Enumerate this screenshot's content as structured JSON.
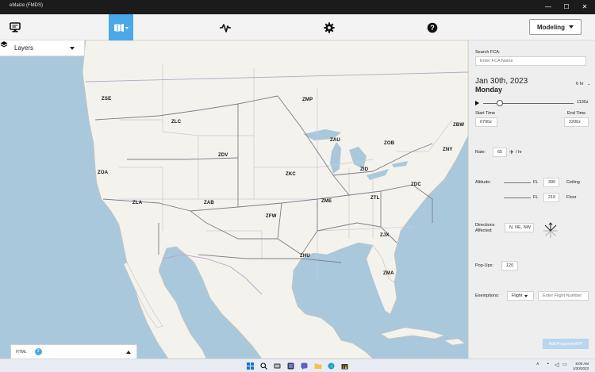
{
  "window": {
    "title": "eMaize (FMDS)",
    "minimize": "—",
    "maximize": "☐",
    "close": "✕"
  },
  "toolbar": {
    "modeling_label": "Modeling"
  },
  "map": {
    "layers_label": "Layers",
    "centers": [
      {
        "name": "ZSE"
      },
      {
        "name": "ZLC"
      },
      {
        "name": "ZMP"
      },
      {
        "name": "ZBW"
      },
      {
        "name": "ZOA"
      },
      {
        "name": "ZDV"
      },
      {
        "name": "ZAU"
      },
      {
        "name": "ZOB"
      },
      {
        "name": "ZNY"
      },
      {
        "name": "ZKC"
      },
      {
        "name": "ZID"
      },
      {
        "name": "ZDC"
      },
      {
        "name": "ZLA"
      },
      {
        "name": "ZAB"
      },
      {
        "name": "ZME"
      },
      {
        "name": "ZTL"
      },
      {
        "name": "ZFW"
      },
      {
        "name": "ZJX"
      },
      {
        "name": "ZHU"
      },
      {
        "name": "ZMA"
      }
    ],
    "html_bar": {
      "label": "HTML",
      "count": "2"
    }
  },
  "panel": {
    "search_label": "Search FCA:",
    "search_placeholder": "Enter FCA Name",
    "date": "Jan 30th, 2023",
    "day": "Monday",
    "duration": "6 hr",
    "slider_time": "1130z",
    "slider_position": 0.18,
    "start_time_label": "Start Time",
    "start_time": "0700z",
    "end_time_label": "End Time",
    "end_time": "2200z",
    "rate_label": "Rate:",
    "rate": "65",
    "rate_unit": "/ hr",
    "altitude_label": "Altitude:",
    "fl_label": "FL",
    "ceiling_value": "390",
    "ceiling_label": "Ceiling",
    "floor_value": "210",
    "floor_label": "Floor",
    "directions_label": "Directions Affected:",
    "directions_value": "N, NE, NW",
    "popups_label": "Pop-Ups:",
    "popups_value": "120",
    "exemptions_label": "Exemptions:",
    "exemption_type": "Flight",
    "flight_placeholder": "Enter Flight Number",
    "add_button": "Add Proposed AFP"
  },
  "taskbar": {
    "time": "8:00 AM",
    "date": "1/30/2023"
  }
}
